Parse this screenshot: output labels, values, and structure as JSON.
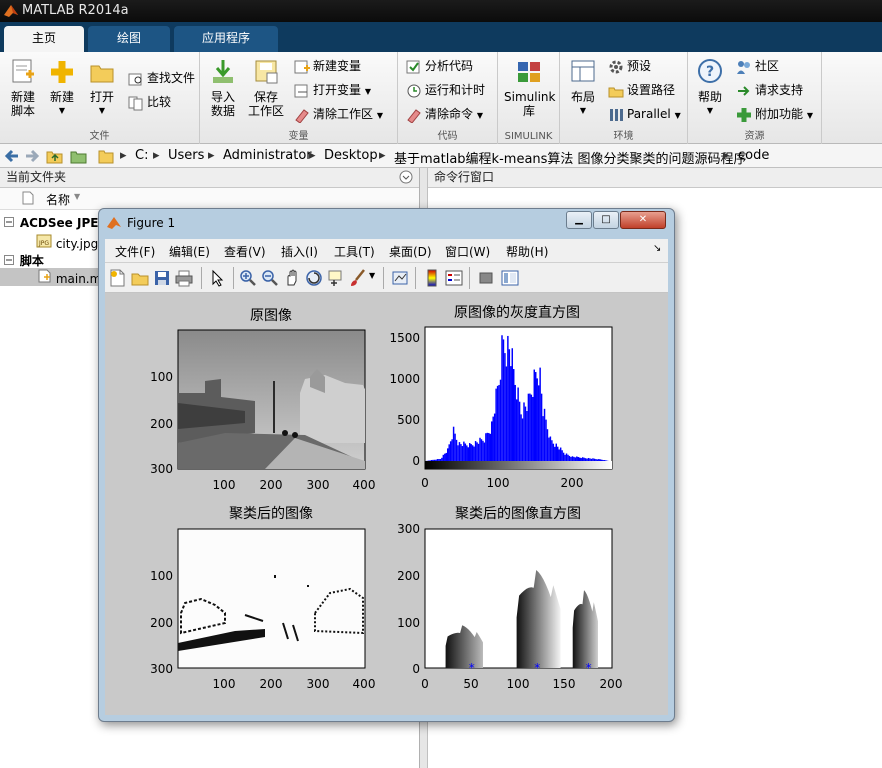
{
  "app": {
    "title": "MATLAB R2014a"
  },
  "tabs": [
    {
      "label": "主页"
    },
    {
      "label": "绘图"
    },
    {
      "label": "应用程序"
    }
  ],
  "ribbon": {
    "file": {
      "label": "文件",
      "new_script": [
        "新建",
        "脚本"
      ],
      "new": "新建",
      "open": "打开",
      "find_files": "查找文件",
      "compare": "比较"
    },
    "variable": {
      "label": "变量",
      "import": [
        "导入",
        "数据"
      ],
      "save": [
        "保存",
        "工作区"
      ],
      "new_var": "新建变量",
      "open_var": "打开变量",
      "clear_ws": "清除工作区"
    },
    "code": {
      "label": "代码",
      "analyze": "分析代码",
      "run_time": "运行和计时",
      "clear_cmds": "清除命令"
    },
    "simulink": {
      "label": "SIMULINK",
      "lib": [
        "Simulink",
        "库"
      ]
    },
    "env": {
      "label": "环境",
      "layout": "布局",
      "prefs": "预设",
      "set_path": "设置路径",
      "parallel": "Parallel"
    },
    "resources": {
      "label": "资源",
      "help": "帮助",
      "community": "社区",
      "support": "请求支持",
      "addons": "附加功能"
    }
  },
  "address": {
    "parts": [
      "C:",
      "Users",
      "Administrator",
      "Desktop",
      "基于matlab编程k-means算法 图像分类聚类的问题源码程序",
      "code"
    ]
  },
  "current_folder": {
    "title": "当前文件夹",
    "column": "名称",
    "items": [
      {
        "label": "ACDSee JPEG"
      },
      {
        "label": "city.jpg"
      },
      {
        "label": "脚本"
      },
      {
        "label": "main.m"
      }
    ]
  },
  "command_window": {
    "title": "命令行窗口"
  },
  "figure": {
    "title": "Figure 1",
    "menu": [
      "文件(F)",
      "编辑(E)",
      "查看(V)",
      "插入(I)",
      "工具(T)",
      "桌面(D)",
      "窗口(W)",
      "帮助(H)"
    ],
    "tools": [
      "new-figure-icon",
      "open-icon",
      "save-icon",
      "print-icon",
      "pointer-icon",
      "zoom-in-icon",
      "zoom-out-icon",
      "pan-icon",
      "rotate-icon",
      "data-cursor-icon",
      "brush-icon",
      "link-icon",
      "colorbar-icon",
      "legend-icon",
      "hide-plot-tools-icon",
      "show-plot-tools-icon"
    ]
  },
  "plots": [
    {
      "title": "原图像",
      "yticks": [
        "100",
        "200",
        "300"
      ],
      "xticks": [
        "100",
        "200",
        "300",
        "400"
      ]
    },
    {
      "title": "原图像的灰度直方图",
      "yticks": [
        "0",
        "500",
        "1000",
        "1500"
      ],
      "xticks": [
        "0",
        "100",
        "200"
      ]
    },
    {
      "title": "聚类后的图像",
      "yticks": [
        "100",
        "200",
        "300"
      ],
      "xticks": [
        "100",
        "200",
        "300",
        "400"
      ]
    },
    {
      "title": "聚类后的图像直方图",
      "yticks": [
        "0",
        "100",
        "200",
        "300"
      ],
      "xticks": [
        "0",
        "50",
        "100",
        "150",
        "200"
      ]
    }
  ],
  "chart_data": [
    {
      "type": "bar",
      "title": "原图像的灰度直方图",
      "xlim": [
        0,
        255
      ],
      "ylim": [
        0,
        1650
      ],
      "x": [
        0,
        20,
        30,
        38,
        45,
        60,
        80,
        90,
        100,
        105,
        110,
        115,
        120,
        130,
        140,
        150,
        155,
        160,
        170,
        180,
        190,
        200,
        220,
        240,
        250
      ],
      "values": [
        0,
        30,
        150,
        420,
        240,
        220,
        300,
        500,
        1100,
        1650,
        1600,
        1550,
        1200,
        700,
        800,
        1200,
        1300,
        700,
        300,
        200,
        100,
        60,
        40,
        20,
        0
      ],
      "colors": {
        "bars": "#0000ff"
      }
    },
    {
      "type": "bar",
      "title": "聚类后的图像直方图",
      "xlim": [
        0,
        200
      ],
      "ylim": [
        0,
        300
      ],
      "segments": [
        {
          "x_start": 22,
          "x_end": 62,
          "peak": 85,
          "marker_x": 50
        },
        {
          "x_start": 98,
          "x_end": 145,
          "peak": 195,
          "marker_x": 120
        },
        {
          "x_start": 158,
          "x_end": 185,
          "peak": 155,
          "marker_x": 175
        }
      ],
      "markers": [
        50,
        120,
        175
      ],
      "colors": {
        "marker": "#0000ff"
      }
    }
  ]
}
